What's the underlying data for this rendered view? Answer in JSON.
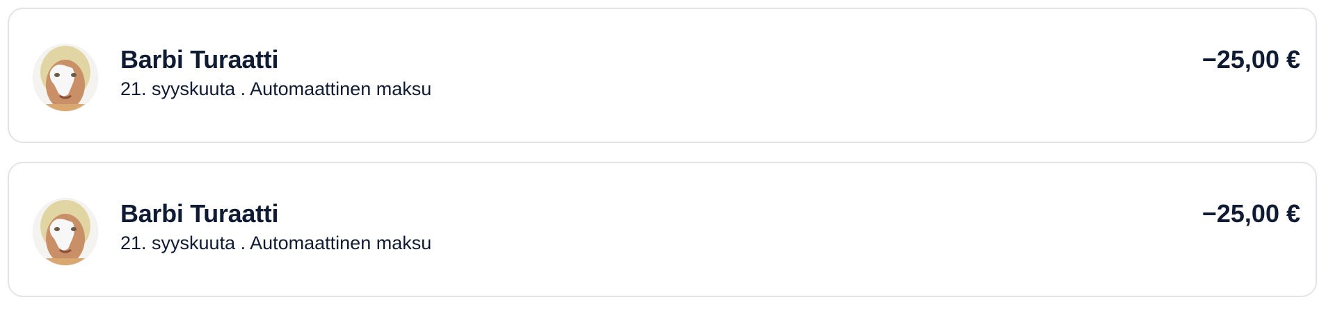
{
  "transactions": [
    {
      "avatar_icon": "user-photo-avatar",
      "name": "Barbi Turaatti",
      "meta": "21. syyskuuta . Automaattinen maksu",
      "amount": "−25,00 €"
    },
    {
      "avatar_icon": "user-photo-avatar",
      "name": "Barbi Turaatti",
      "meta": "21. syyskuuta . Automaattinen maksu",
      "amount": "−25,00 €"
    }
  ],
  "colors": {
    "text": "#0f1a33",
    "card_border": "#e3e4e8",
    "background": "#ffffff"
  }
}
